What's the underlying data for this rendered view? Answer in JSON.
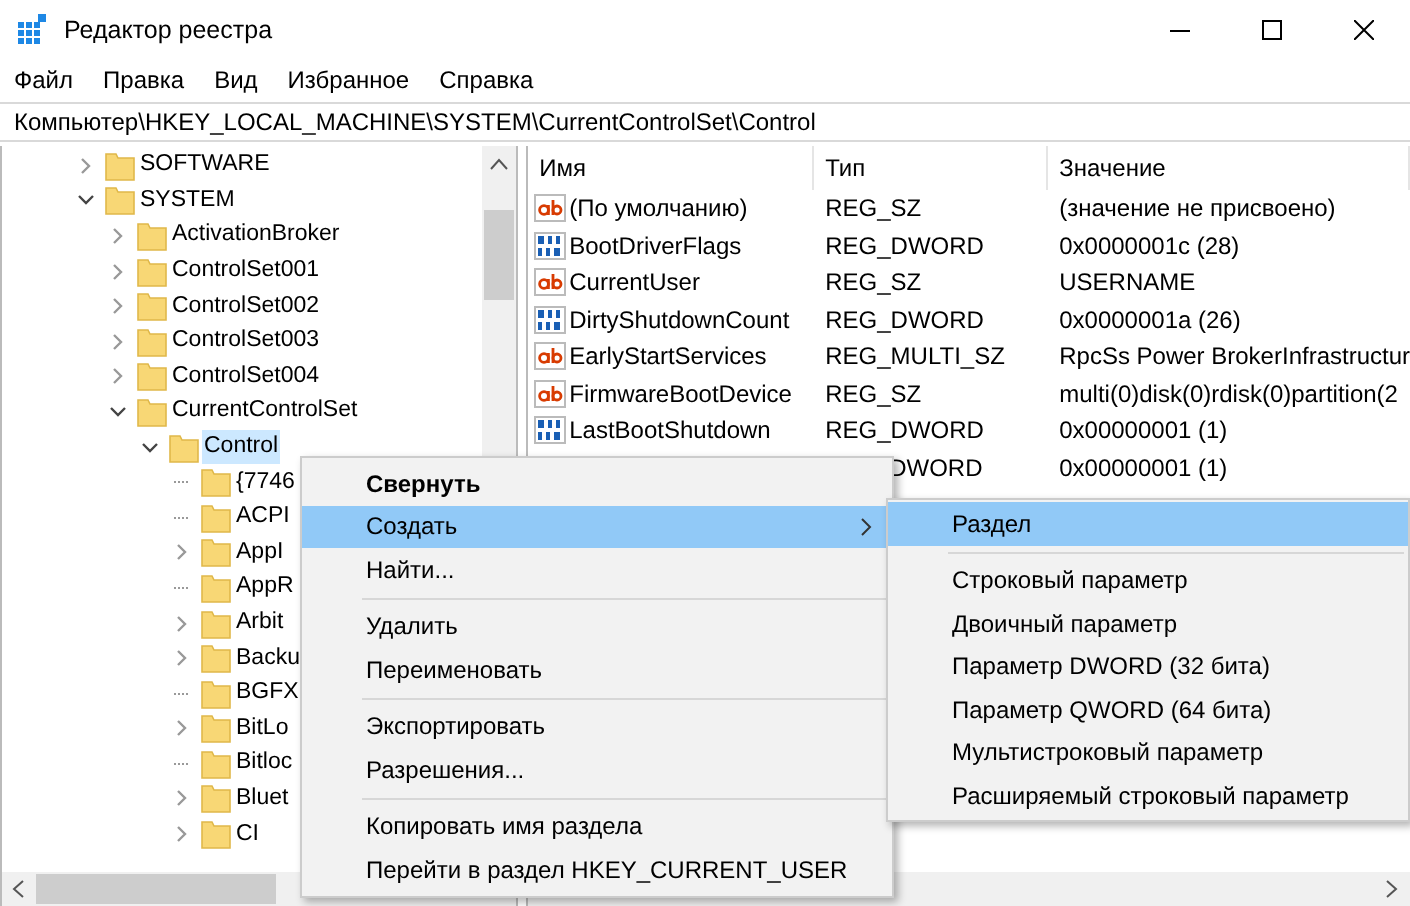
{
  "window": {
    "title": "Редактор реестра"
  },
  "menu_bar": [
    "Файл",
    "Правка",
    "Вид",
    "Избранное",
    "Справка"
  ],
  "address_bar": "Компьютер\\HKEY_LOCAL_MACHINE\\SYSTEM\\CurrentControlSet\\Control",
  "tree": [
    {
      "label": "SOFTWARE",
      "expandable": true,
      "expanded": false,
      "selected": false
    },
    {
      "label": "SYSTEM",
      "expandable": true,
      "expanded": true,
      "selected": false,
      "children": [
        {
          "label": "ActivationBroker",
          "expandable": true,
          "expanded": false,
          "selected": false
        },
        {
          "label": "ControlSet001",
          "expandable": true,
          "expanded": false,
          "selected": false
        },
        {
          "label": "ControlSet002",
          "expandable": true,
          "expanded": false,
          "selected": false
        },
        {
          "label": "ControlSet003",
          "expandable": true,
          "expanded": false,
          "selected": false
        },
        {
          "label": "ControlSet004",
          "expandable": true,
          "expanded": false,
          "selected": false
        },
        {
          "label": "CurrentControlSet",
          "expandable": true,
          "expanded": true,
          "selected": false,
          "children": [
            {
              "label": "Control",
              "expandable": true,
              "expanded": true,
              "selected": true,
              "children": [
                {
                  "label": "{7746",
                  "expandable": false,
                  "selected": false
                },
                {
                  "label": "ACPI",
                  "expandable": false,
                  "selected": false
                },
                {
                  "label": "AppI",
                  "expandable": true,
                  "expanded": false,
                  "selected": false
                },
                {
                  "label": "AppR",
                  "expandable": false,
                  "selected": false
                },
                {
                  "label": "Arbit",
                  "expandable": true,
                  "expanded": false,
                  "selected": false
                },
                {
                  "label": "Backu",
                  "expandable": true,
                  "expanded": false,
                  "selected": false
                },
                {
                  "label": "BGFX",
                  "expandable": false,
                  "selected": false
                },
                {
                  "label": "BitLo",
                  "expandable": true,
                  "expanded": false,
                  "selected": false
                },
                {
                  "label": "Bitloc",
                  "expandable": false,
                  "selected": false
                },
                {
                  "label": "Bluet",
                  "expandable": true,
                  "expanded": false,
                  "selected": false
                },
                {
                  "label": "CI",
                  "expandable": true,
                  "expanded": false,
                  "selected": false
                }
              ]
            }
          ]
        }
      ]
    }
  ],
  "values_table": {
    "columns": [
      "Имя",
      "Тип",
      "Значение"
    ],
    "rows": [
      {
        "kind": "string",
        "name": "(По умолчанию)",
        "type": "REG_SZ",
        "value": "(значение не присвоено)"
      },
      {
        "kind": "binary",
        "name": "BootDriverFlags",
        "type": "REG_DWORD",
        "value": "0x0000001c (28)"
      },
      {
        "kind": "string",
        "name": "CurrentUser",
        "type": "REG_SZ",
        "value": "USERNAME"
      },
      {
        "kind": "binary",
        "name": "DirtyShutdownCount",
        "type": "REG_DWORD",
        "value": "0x0000001a (26)"
      },
      {
        "kind": "string",
        "name": "EarlyStartServices",
        "type": "REG_MULTI_SZ",
        "value": "RpcSs Power BrokerInfrastructur"
      },
      {
        "kind": "string",
        "name": "FirmwareBootDevice",
        "type": "REG_SZ",
        "value": "multi(0)disk(0)rdisk(0)partition(2"
      },
      {
        "kind": "binary",
        "name": "LastBootShutdown",
        "type": "REG_DWORD",
        "value": "0x00000001 (1)"
      },
      {
        "kind": "hidden",
        "type": "DWORD",
        "value": "0x00000001 (1)"
      }
    ]
  },
  "context_menu": [
    {
      "kind": "item",
      "label": "Свернуть",
      "bold": true,
      "selected": false,
      "submenu": false
    },
    {
      "kind": "item",
      "label": "Создать",
      "bold": false,
      "selected": true,
      "submenu": true
    },
    {
      "kind": "item",
      "label": "Найти...",
      "bold": false,
      "selected": false,
      "submenu": false
    },
    {
      "kind": "separator"
    },
    {
      "kind": "item",
      "label": "Удалить",
      "bold": false,
      "selected": false,
      "submenu": false
    },
    {
      "kind": "item",
      "label": "Переименовать",
      "bold": false,
      "selected": false,
      "submenu": false
    },
    {
      "kind": "separator"
    },
    {
      "kind": "item",
      "label": "Экспортировать",
      "bold": false,
      "selected": false,
      "submenu": false
    },
    {
      "kind": "item",
      "label": "Разрешения...",
      "bold": false,
      "selected": false,
      "submenu": false
    },
    {
      "kind": "separator"
    },
    {
      "kind": "item",
      "label": "Копировать имя раздела",
      "bold": false,
      "selected": false,
      "submenu": false
    },
    {
      "kind": "item",
      "label": "Перейти в раздел HKEY_CURRENT_USER",
      "bold": false,
      "selected": false,
      "submenu": false
    }
  ],
  "submenu": [
    {
      "kind": "item",
      "label": "Раздел",
      "selected": true
    },
    {
      "kind": "separator"
    },
    {
      "kind": "item",
      "label": "Строковый параметр",
      "selected": false
    },
    {
      "kind": "item",
      "label": "Двоичный параметр",
      "selected": false
    },
    {
      "kind": "item",
      "label": "Параметр DWORD (32 бита)",
      "selected": false
    },
    {
      "kind": "item",
      "label": "Параметр QWORD (64 бита)",
      "selected": false
    },
    {
      "kind": "item",
      "label": "Мультистроковый параметр",
      "selected": false
    },
    {
      "kind": "item",
      "label": "Расширяемый строковый параметр",
      "selected": false
    }
  ]
}
